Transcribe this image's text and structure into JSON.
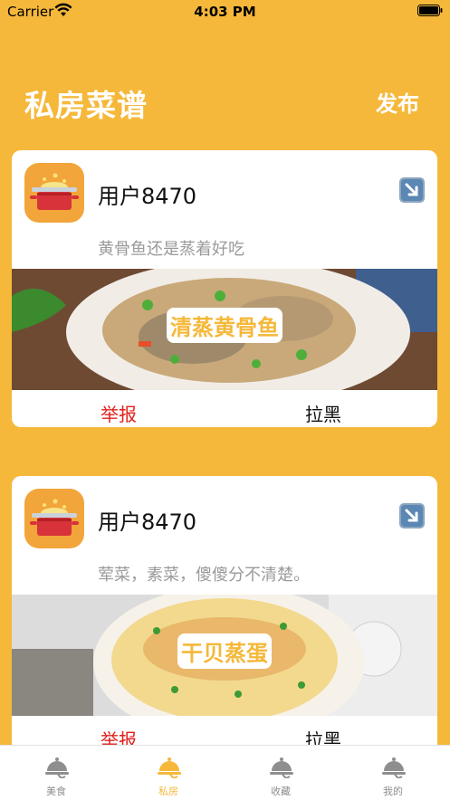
{
  "status_bar": {
    "carrier": "Carrier",
    "time": "4:03 PM"
  },
  "header": {
    "title": "私房菜谱",
    "publish": "发布"
  },
  "posts": [
    {
      "username": "用户8470",
      "description": "黄骨鱼还是蒸着好吃",
      "dish": "清蒸黄骨鱼",
      "report": "举报",
      "block": "拉黑"
    },
    {
      "username": "用户8470",
      "description": "荤菜，素菜，傻傻分不清楚。",
      "dish": "干贝蒸蛋",
      "report": "举报",
      "block": "拉黑"
    }
  ],
  "tabs": [
    {
      "label": "美食",
      "icon": "cloche-icon"
    },
    {
      "label": "私房",
      "icon": "cloche-icon"
    },
    {
      "label": "收藏",
      "icon": "cloche-icon"
    },
    {
      "label": "我的",
      "icon": "cloche-icon"
    }
  ],
  "colors": {
    "accent": "#F5B83A",
    "report": "#E0201C",
    "tab_inactive": "#8E8E8E"
  }
}
